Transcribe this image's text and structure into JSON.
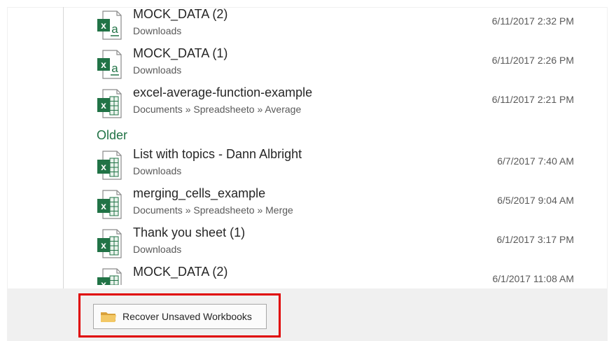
{
  "recent_files": [
    {
      "name": "MOCK_DATA (2)",
      "path": "Downloads",
      "date": "6/11/2017 2:32 PM",
      "icon": "csv-icon"
    },
    {
      "name": "MOCK_DATA (1)",
      "path": "Downloads",
      "date": "6/11/2017 2:26 PM",
      "icon": "csv-icon"
    },
    {
      "name": "excel-average-function-example",
      "path": "Documents » Spreadsheeto » Average",
      "date": "6/11/2017 2:21 PM",
      "icon": "xlsx-icon"
    }
  ],
  "older_header": "Older",
  "older_files": [
    {
      "name": "List with topics - Dann Albright",
      "path": "Downloads",
      "date": "6/7/2017 7:40 AM",
      "icon": "xlsx-icon"
    },
    {
      "name": "merging_cells_example",
      "path": "Documents » Spreadsheeto » Merge",
      "date": "6/5/2017 9:04 AM",
      "icon": "xlsx-icon"
    },
    {
      "name": "Thank you sheet (1)",
      "path": "Downloads",
      "date": "6/1/2017 3:17 PM",
      "icon": "xlsx-icon"
    },
    {
      "name": "MOCK_DATA (2)",
      "path": "",
      "date": "6/1/2017 11:08 AM",
      "icon": "xlsx-icon"
    }
  ],
  "recover_button": {
    "label": "Recover Unsaved Workbooks",
    "icon": "folder-icon"
  },
  "colors": {
    "excel_green": "#217346",
    "highlight_red": "#e00000",
    "folder_yellow": "#e8b64c"
  }
}
